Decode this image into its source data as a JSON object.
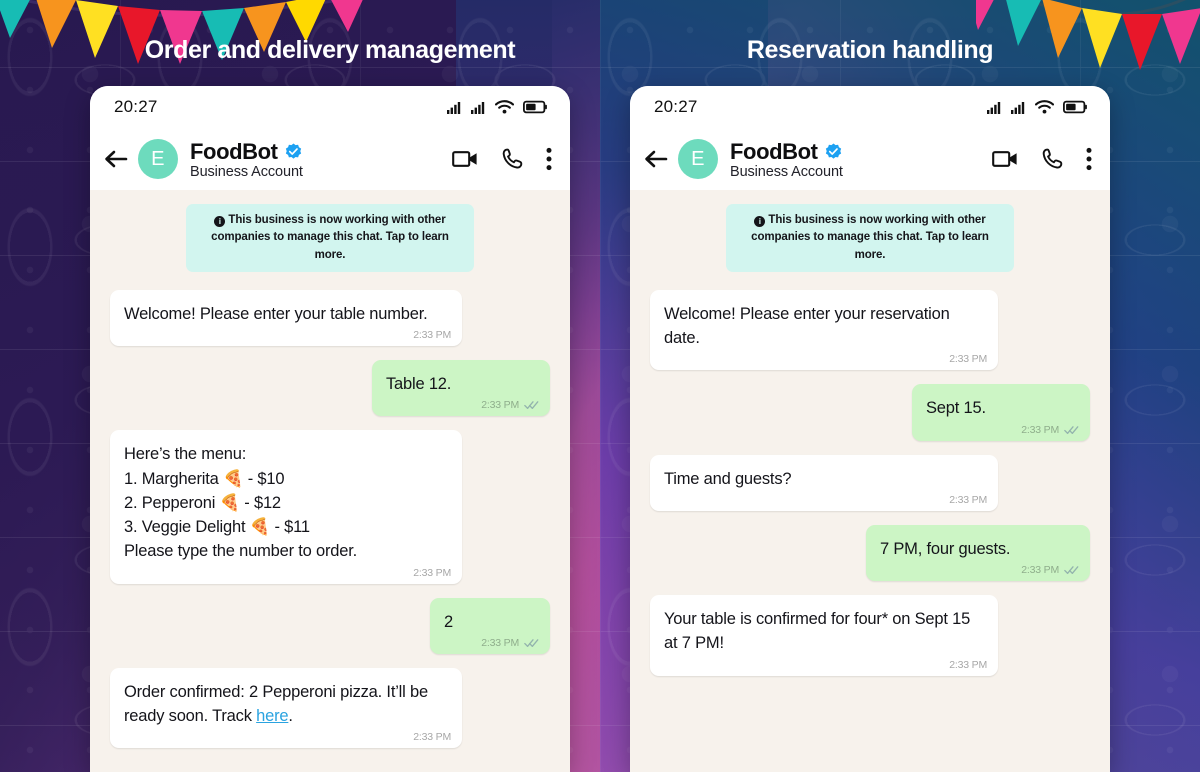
{
  "background": {
    "colors": {
      "dark_purple": "#2b1a52",
      "magenta": "#c8589f",
      "teal": "#14526b",
      "blue_purple": "#5d3093"
    },
    "bunting_colors": [
      "#f28f16",
      "#ffe022",
      "#e8172a",
      "#f0378f",
      "#17bcb4",
      "#f7941e",
      "#ffd900"
    ]
  },
  "panels": [
    {
      "title": "Order and delivery management",
      "phone": {
        "status_bar": {
          "time": "20:27",
          "icons": [
            "signal-icon",
            "signal-icon",
            "wifi-icon",
            "battery-icon"
          ]
        },
        "header": {
          "back_icon": "back-arrow-icon",
          "avatar_letter": "E",
          "avatar_color": "#6ddbbd",
          "name": "FoodBot",
          "verified": true,
          "subtitle": "Business Account",
          "actions": [
            "video-call-icon",
            "phone-call-icon",
            "more-options-icon"
          ]
        },
        "notice": "This business is now working with other companies to manage this chat. Tap to learn more.",
        "messages": [
          {
            "side": "in",
            "text": "Welcome! Please enter your table number.",
            "time": "2:33 PM",
            "ticks": false,
            "width_class": "w-welcome-l"
          },
          {
            "side": "out",
            "text": "Table 12.",
            "time": "2:33 PM",
            "ticks": true,
            "width_class": "w-table"
          },
          {
            "side": "in",
            "text": "Here’s the menu:\n1. Margherita 🍕 - $10\n2. Pepperoni 🍕 - $12\n3. Veggie Delight 🍕 - $11\nPlease type the number to order.",
            "time": "2:33 PM",
            "ticks": false,
            "width_class": "w-menu"
          },
          {
            "side": "out",
            "text": "2",
            "time": "2:33 PM",
            "ticks": true,
            "width_class": "w-two"
          },
          {
            "side": "in",
            "html": "Order confirmed: 2 Pepperoni pizza. It’ll be ready soon. Track <a href=\"#\">here</a>.",
            "time": "2:33 PM",
            "ticks": false,
            "width_class": "w-order"
          }
        ]
      }
    },
    {
      "title": "Reservation handling",
      "phone": {
        "status_bar": {
          "time": "20:27",
          "icons": [
            "signal-icon",
            "signal-icon",
            "wifi-icon",
            "battery-icon"
          ]
        },
        "header": {
          "back_icon": "back-arrow-icon",
          "avatar_letter": "E",
          "avatar_color": "#6ddbbd",
          "name": "FoodBot",
          "verified": true,
          "subtitle": "Business Account",
          "actions": [
            "video-call-icon",
            "phone-call-icon",
            "more-options-icon"
          ]
        },
        "notice": "This business is now working with other companies to manage this chat. Tap to learn more.",
        "messages": [
          {
            "side": "in",
            "text": "Welcome! Please enter your reservation date.",
            "time": "2:33 PM",
            "ticks": false,
            "width_class": "w-welcome-r"
          },
          {
            "side": "out",
            "text": "Sept 15.",
            "time": "2:33 PM",
            "ticks": true,
            "width_class": "w-sept"
          },
          {
            "side": "in",
            "text": "Time and guests?",
            "time": "2:33 PM",
            "ticks": false,
            "width_class": "w-time"
          },
          {
            "side": "out",
            "text": "7 PM, four guests.",
            "time": "2:33 PM",
            "ticks": true,
            "width_class": "w-7pm"
          },
          {
            "side": "in",
            "text": "Your table is confirmed for four* on Sept 15 at 7 PM!",
            "time": "2:33 PM",
            "ticks": false,
            "width_class": "w-confirm"
          }
        ]
      }
    }
  ]
}
